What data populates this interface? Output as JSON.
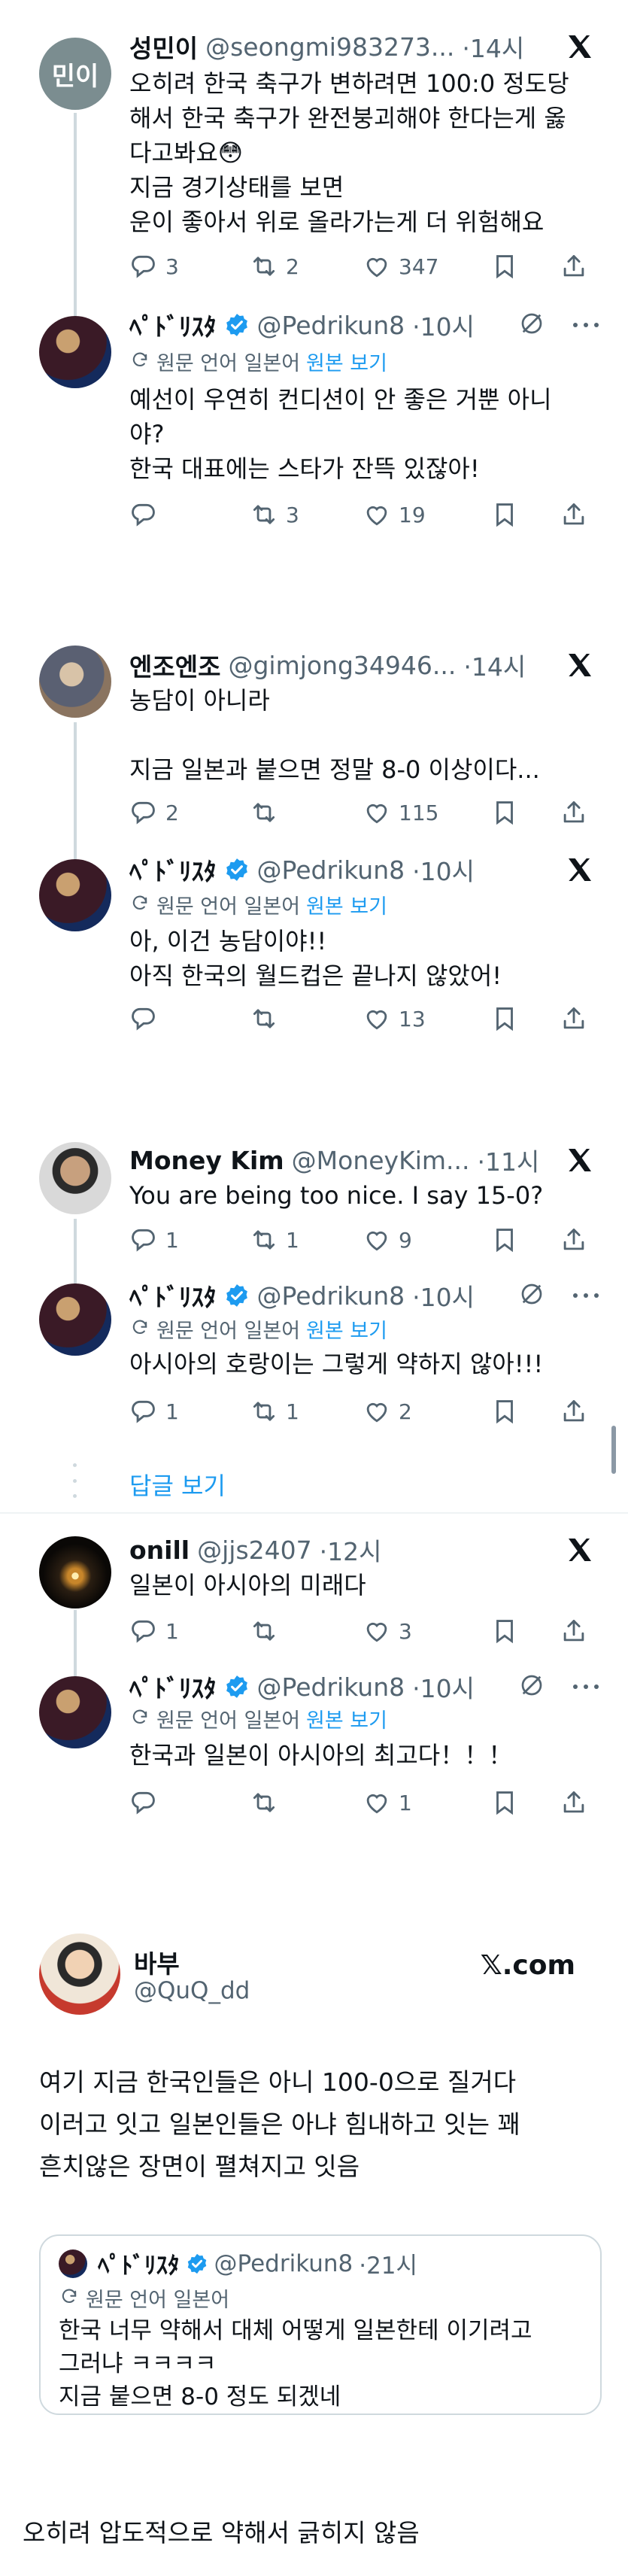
{
  "t1": {
    "reply": {
      "name": "성민이",
      "handle": "@seongmi983273...",
      "time": "·14시",
      "avatar_text": "민이",
      "lines": "오히려 한국 축구가 변하려면 100:0 정도당\n해서 한국 축구가 완전붕괴해야 한다는게 옳\n다고봐요😳\n지금 경기상태를 보면\n운이 좋아서 위로 올라가는게 더 위험해요",
      "replies": "3",
      "retweets": "2",
      "likes": "347"
    },
    "answer": {
      "name": "ﾍﾟﾄﾞﾘｽﾀ",
      "handle": "@Pedrikun8",
      "time": "·10시",
      "translate_label": "원문 언어 일본어",
      "translate_link": "원본 보기",
      "lines": "예선이 우연히 컨디션이 안 좋은 거뿐 아니\n야?\n한국 대표에는 스타가 잔뜩 있잖아!",
      "replies": "",
      "retweets": "3",
      "likes": "19"
    }
  },
  "t2": {
    "reply": {
      "name": "엔조엔조",
      "handle": "@gimjong34946...",
      "time": "·14시",
      "lines": "농담이 아니라\n\n지금 일본과 붙으면 정말 8-0 이상이다...",
      "replies": "2",
      "retweets": "",
      "likes": "115"
    },
    "answer": {
      "name": "ﾍﾟﾄﾞﾘｽﾀ",
      "handle": "@Pedrikun8",
      "time": "·10시",
      "translate_label": "원문 언어 일본어",
      "translate_link": "원본 보기",
      "lines": "아, 이건 농담이야!!\n아직 한국의 월드컵은 끝나지 않았어!",
      "replies": "",
      "retweets": "",
      "likes": "13"
    }
  },
  "t3": {
    "reply": {
      "name": "Money Kim",
      "handle": "@MoneyKim...",
      "time": "·11시",
      "lines": "You are being too nice. I say 15-0?",
      "replies": "1",
      "retweets": "1",
      "likes": "9"
    },
    "answer": {
      "name": "ﾍﾟﾄﾞﾘｽﾀ",
      "handle": "@Pedrikun8",
      "time": "·10시",
      "translate_label": "원문 언어 일본어",
      "translate_link": "원본 보기",
      "lines": "아시아의 호랑이는 그렇게 약하지 않아!!!",
      "replies": "1",
      "retweets": "1",
      "likes": "2"
    },
    "show_replies": "답글 보기"
  },
  "t4": {
    "reply": {
      "name": "onill",
      "handle": "@jjs2407",
      "time": "·12시",
      "lines": "일본이 아시아의 미래다",
      "replies": "1",
      "retweets": "",
      "likes": "3"
    },
    "answer": {
      "name": "ﾍﾟﾄﾞﾘｽﾀ",
      "handle": "@Pedrikun8",
      "time": "·10시",
      "translate_label": "원문 언어 일본어",
      "translate_link": "원본 보기",
      "lines": "한국과 일본이 아시아의 최고다！！！",
      "replies": "",
      "retweets": "",
      "likes": "1"
    }
  },
  "quote_card": {
    "name": "바부",
    "handle": "@QuQ_dd",
    "brand": "𝕏.com",
    "lines": "여기 지금 한국인들은 아니 100-0으로 질거다\n이러고 잇고 일본인들은 아냐 힘내하고 잇는 꽤\n흔치않은 장면이 펼쳐지고 잇음",
    "quoted": {
      "name": "ﾍﾟﾄﾞﾘｽﾀ",
      "handle": "@Pedrikun8",
      "time": "·21시",
      "translate_label": "원문 언어 일본어",
      "lines": "한국 너무 약해서 대체 어떻게 일본한테 이기려고\n그러냐 ㅋㅋㅋㅋ\n지금 붙으면 8-0 정도 되겠네"
    }
  },
  "caption": "오히려 압도적으로 약해서 긁히지 않음",
  "colors": {
    "accent": "#1d9bf0",
    "muted": "#536471",
    "line": "#cfd9de",
    "text": "#0f1419"
  }
}
